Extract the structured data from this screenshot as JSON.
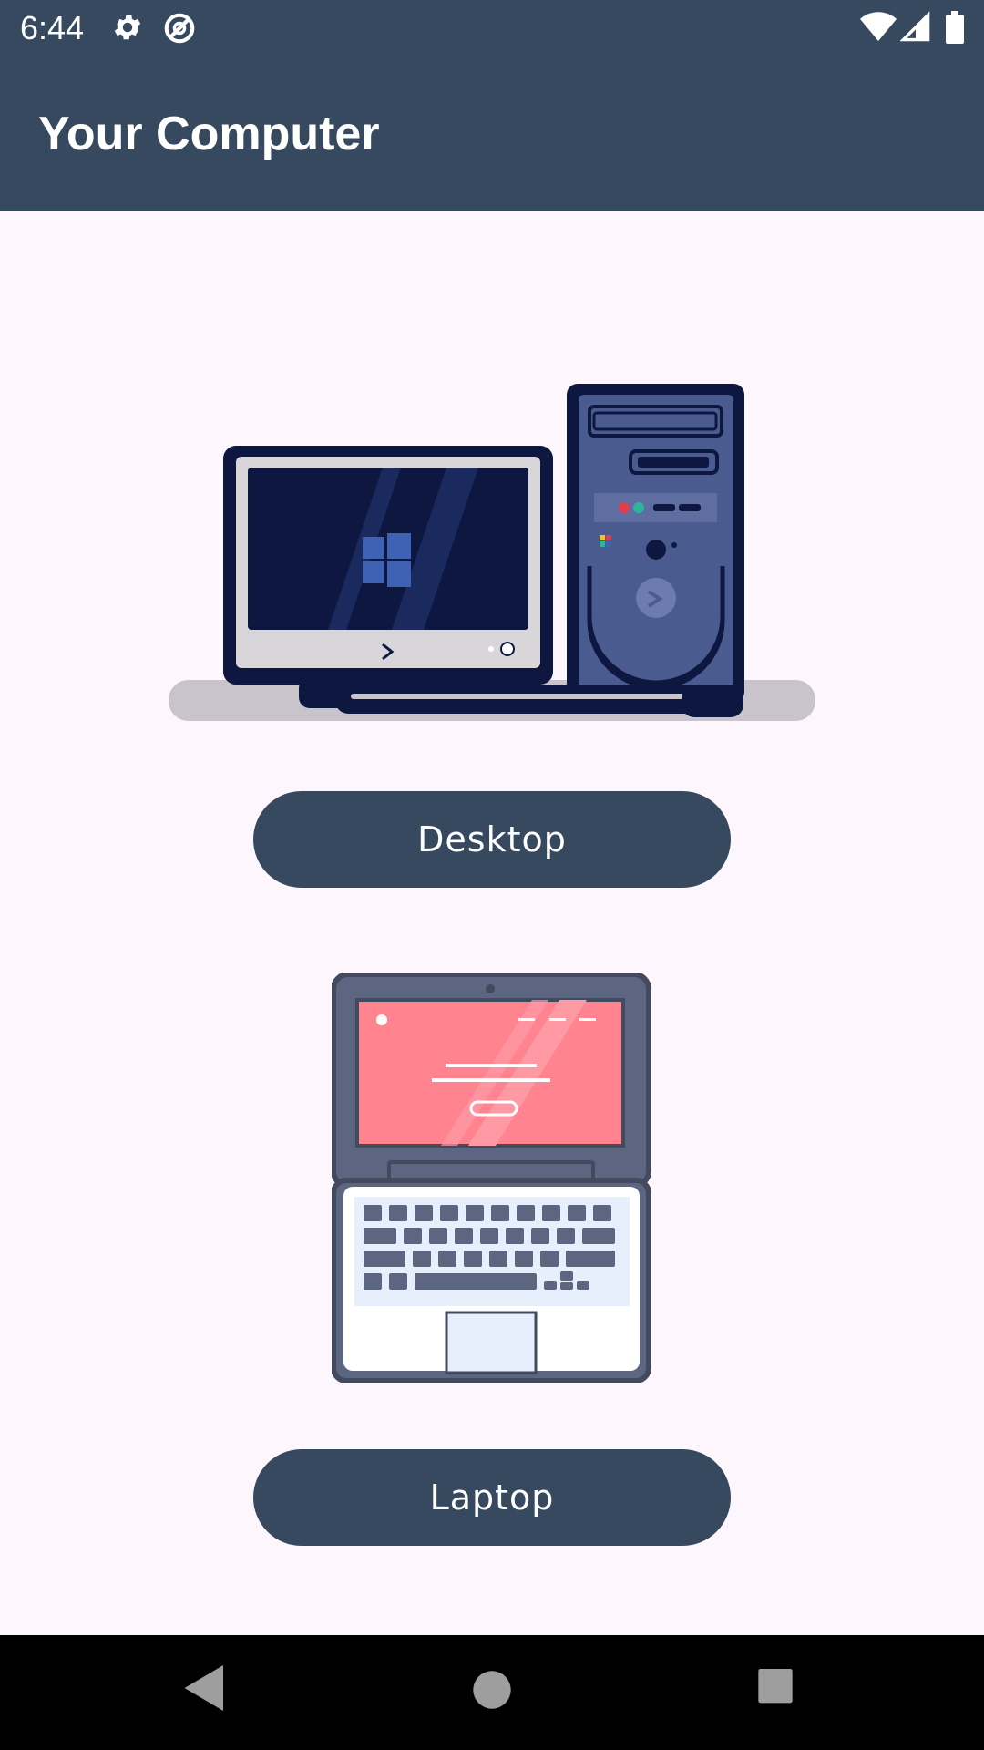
{
  "status_bar": {
    "time": "6:44",
    "left_icons": [
      "settings-icon",
      "no-disturb-icon"
    ],
    "right_icons": [
      "wifi-icon",
      "signal-icon",
      "battery-icon"
    ]
  },
  "app_bar": {
    "title": "Your Computer"
  },
  "options": [
    {
      "label": "Desktop",
      "illustration": "desktop-computer-illustration"
    },
    {
      "label": "Laptop",
      "illustration": "laptop-illustration"
    }
  ],
  "nav_bar": {
    "buttons": [
      "back-icon",
      "home-icon",
      "recents-icon"
    ]
  },
  "colors": {
    "primary": "#36495f",
    "background": "#fdf7fd",
    "nav": "#000000"
  }
}
